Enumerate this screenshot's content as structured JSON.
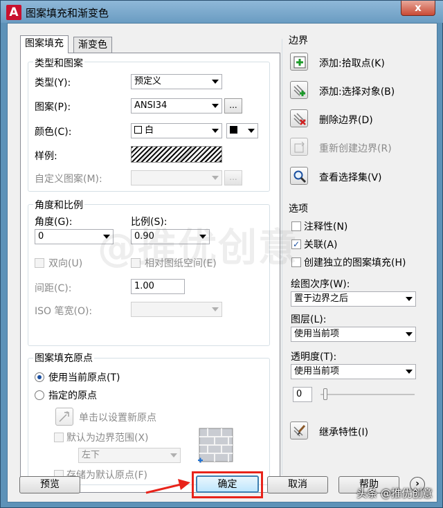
{
  "window": {
    "title": "图案填充和渐变色",
    "close_glyph": "x"
  },
  "tabs": [
    {
      "label": "图案填充"
    },
    {
      "label": "渐变色"
    }
  ],
  "type_pattern": {
    "group_title": "类型和图案",
    "type_label": "类型(Y):",
    "type_value": "预定义",
    "pattern_label": "图案(P):",
    "pattern_value": "ANSI34",
    "pattern_btn": "...",
    "color_label": "颜色(C):",
    "color_value": "白",
    "sample_label": "样例:",
    "custom_label": "自定义图案(M):",
    "custom_btn": "..."
  },
  "angle_scale": {
    "group_title": "角度和比例",
    "angle_label": "角度(G):",
    "angle_value": "0",
    "scale_label": "比例(S):",
    "scale_value": "0.90",
    "double_label": "双向(U)",
    "relative_label": "相对图纸空间(E)",
    "spacing_label": "间距(C):",
    "spacing_value": "1.00",
    "iso_label": "ISO 笔宽(O):"
  },
  "origin": {
    "group_title": "图案填充原点",
    "current_label": "使用当前原点(T)",
    "specified_label": "指定的原点",
    "click_label": "单击以设置新原点",
    "default_extents_label": "默认为边界范围(X)",
    "position_value": "左下",
    "store_label": "存储为默认原点(F)"
  },
  "boundaries": {
    "title": "边界",
    "add_pick": "添加:拾取点(K)",
    "add_select": "添加:选择对象(B)",
    "remove": "删除边界(D)",
    "recreate": "重新创建边界(R)",
    "view": "查看选择集(V)"
  },
  "options": {
    "title": "选项",
    "annotative": "注释性(N)",
    "associative": "关联(A)",
    "separate": "创建独立的图案填充(H)",
    "draw_order_label": "绘图次序(W):",
    "draw_order_value": "置于边界之后",
    "layer_label": "图层(L):",
    "layer_value": "使用当前项",
    "transparency_label": "透明度(T):",
    "transparency_value": "使用当前项",
    "transparency_number": "0",
    "inherit": "继承特性(I)"
  },
  "footer": {
    "preview": "预览",
    "ok": "确定",
    "cancel": "取消",
    "help": "帮助",
    "more_glyph": "›"
  },
  "watermark": "@推优创意",
  "footer_watermark": "头条 @推优创意",
  "colors": {
    "title_bar": "#6a9cc2",
    "highlight": "#e8231a",
    "accent": "#1a4fa0"
  }
}
